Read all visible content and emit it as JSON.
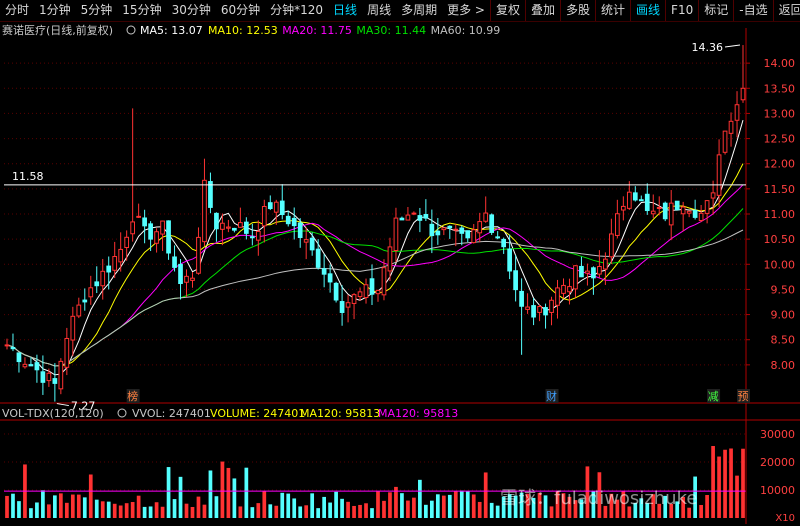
{
  "toolbar": {
    "items": [
      "分时",
      "1分钟",
      "5分钟",
      "15分钟",
      "30分钟",
      "60分钟",
      "分钟*120",
      "日线",
      "周线",
      "多周期",
      "更多 >"
    ],
    "active_index": 7,
    "right_items": [
      "复权",
      "叠加",
      "多股",
      "统计",
      "画线",
      "F10",
      "标记",
      "-自选",
      "返回"
    ],
    "active_right_index": 4
  },
  "colors": {
    "background": "#000000",
    "up": "#ff3232",
    "down": "#54ffff",
    "ma5": "#ffffff",
    "ma10": "#ffff00",
    "ma20": "#ff00ff",
    "ma30": "#00e000",
    "ma60": "#c0c0c0",
    "axis": "#b00000",
    "grid": "#5a0000"
  },
  "chart_data": [
    {
      "type": "candlestick",
      "title": "赛诺医疗(日线,前复权)",
      "legend": [
        {
          "label": "MA5: 13.07",
          "color": "#ffffff"
        },
        {
          "label": "MA10: 12.53",
          "color": "#ffff00"
        },
        {
          "label": "MA20: 11.75",
          "color": "#ff00ff"
        },
        {
          "label": "MA30: 11.44",
          "color": "#00e000"
        },
        {
          "label": "MA60: 10.99",
          "color": "#c0c0c0"
        }
      ],
      "ylim": [
        7.5,
        14.5
      ],
      "yticks": [
        "14.00",
        "13.50",
        "13.00",
        "12.50",
        "12.00",
        "11.50",
        "11.00",
        "10.50",
        "10.00",
        "9.50",
        "9.00",
        "8.50",
        "8.00"
      ],
      "ytick_values": [
        14.0,
        13.5,
        13.0,
        12.5,
        12.0,
        11.5,
        11.0,
        10.5,
        10.0,
        9.5,
        9.0,
        8.5,
        8.0
      ],
      "hline": {
        "value": 11.58,
        "label": "11.58"
      },
      "annotations": [
        {
          "text": "14.36",
          "value": 14.36,
          "bar_index": 123
        },
        {
          "text": "7.27",
          "value": 7.27,
          "bar_index": 8
        }
      ],
      "markers": [
        {
          "text": "榜",
          "bar_index": 21,
          "color": "#ff8040"
        },
        {
          "text": "财",
          "bar_index": 91,
          "color": "#40a0ff"
        },
        {
          "text": "减",
          "bar_index": 118,
          "color": "#40ff40"
        },
        {
          "text": "预",
          "bar_index": 123,
          "color": "#ff8040"
        }
      ],
      "series_anchor_closes": [
        [
          0,
          8.4
        ],
        [
          3,
          8.1
        ],
        [
          6,
          7.8
        ],
        [
          8,
          7.6
        ],
        [
          10,
          8.6
        ],
        [
          13,
          9.4
        ],
        [
          16,
          9.8
        ],
        [
          19,
          10.3
        ],
        [
          21,
          11.0
        ],
        [
          23,
          10.6
        ],
        [
          26,
          10.7
        ],
        [
          29,
          9.6
        ],
        [
          31,
          9.8
        ],
        [
          33,
          11.5
        ],
        [
          35,
          10.8
        ],
        [
          38,
          10.8
        ],
        [
          41,
          10.6
        ],
        [
          44,
          11.2
        ],
        [
          47,
          10.9
        ],
        [
          50,
          10.4
        ],
        [
          53,
          9.9
        ],
        [
          56,
          9.2
        ],
        [
          59,
          9.4
        ],
        [
          62,
          9.5
        ],
        [
          65,
          10.8
        ],
        [
          68,
          11.1
        ],
        [
          71,
          10.7
        ],
        [
          74,
          10.6
        ],
        [
          77,
          10.4
        ],
        [
          80,
          11.0
        ],
        [
          83,
          10.4
        ],
        [
          86,
          9.1
        ],
        [
          89,
          9.0
        ],
        [
          92,
          9.5
        ],
        [
          95,
          9.8
        ],
        [
          98,
          9.7
        ],
        [
          101,
          10.5
        ],
        [
          104,
          11.6
        ],
        [
          107,
          11.0
        ],
        [
          110,
          11.0
        ],
        [
          113,
          11.3
        ],
        [
          116,
          11.0
        ],
        [
          118,
          11.3
        ],
        [
          119,
          12.3
        ],
        [
          121,
          13.0
        ],
        [
          123,
          13.5
        ]
      ],
      "bar_count": 124
    },
    {
      "type": "bar",
      "title": "VOL-TDX(120,120)",
      "legend": [
        {
          "label": "VVOL: 247401",
          "color": "#c8c8c8"
        },
        {
          "label": "VOLUME: 247401",
          "color": "#ffff00"
        },
        {
          "label": "MA120: 95813",
          "color": "#ffff00"
        },
        {
          "label": "MA120: 95813",
          "color": "#ff00ff"
        }
      ],
      "ylim": [
        0,
        35000
      ],
      "yticks": [
        "30000",
        "20000",
        "10000"
      ],
      "ytick_values": [
        30000,
        20000,
        10000
      ],
      "unit_label": "X10",
      "ma_value": 9581
    }
  ],
  "watermark": "雪球：fuladiwosizhuke"
}
